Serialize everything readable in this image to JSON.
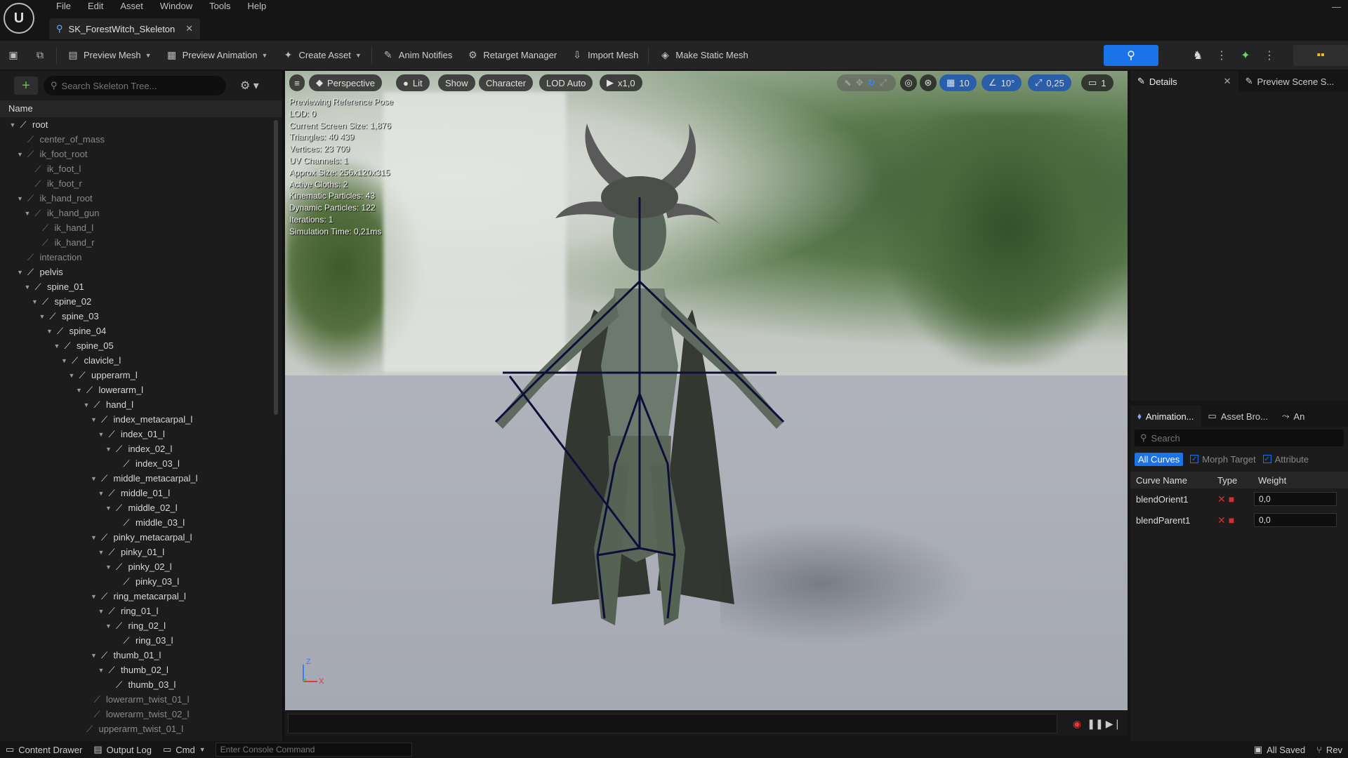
{
  "menu": [
    "File",
    "Edit",
    "Asset",
    "Window",
    "Tools",
    "Help"
  ],
  "doc_tab": {
    "label": "SK_ForestWitch_Skeleton"
  },
  "toolbar": {
    "preview_mesh": "Preview Mesh",
    "preview_animation": "Preview Animation",
    "create_asset": "Create Asset",
    "anim_notifies": "Anim Notifies",
    "retarget_manager": "Retarget Manager",
    "import_mesh": "Import Mesh",
    "make_static_mesh": "Make Static Mesh"
  },
  "skeleton_tree": {
    "search_placeholder": "Search Skeleton Tree...",
    "column_name": "Name",
    "rows": [
      {
        "label": "root",
        "depth": 0,
        "expanded": true,
        "dim": false
      },
      {
        "label": "center_of_mass",
        "depth": 1,
        "expanded": null,
        "dim": true
      },
      {
        "label": "ik_foot_root",
        "depth": 1,
        "expanded": true,
        "dim": true
      },
      {
        "label": "ik_foot_l",
        "depth": 2,
        "expanded": null,
        "dim": true
      },
      {
        "label": "ik_foot_r",
        "depth": 2,
        "expanded": null,
        "dim": true
      },
      {
        "label": "ik_hand_root",
        "depth": 1,
        "expanded": true,
        "dim": true
      },
      {
        "label": "ik_hand_gun",
        "depth": 2,
        "expanded": true,
        "dim": true
      },
      {
        "label": "ik_hand_l",
        "depth": 3,
        "expanded": null,
        "dim": true
      },
      {
        "label": "ik_hand_r",
        "depth": 3,
        "expanded": null,
        "dim": true
      },
      {
        "label": "interaction",
        "depth": 1,
        "expanded": null,
        "dim": true
      },
      {
        "label": "pelvis",
        "depth": 1,
        "expanded": true,
        "dim": false
      },
      {
        "label": "spine_01",
        "depth": 2,
        "expanded": true,
        "dim": false
      },
      {
        "label": "spine_02",
        "depth": 3,
        "expanded": true,
        "dim": false
      },
      {
        "label": "spine_03",
        "depth": 4,
        "expanded": true,
        "dim": false
      },
      {
        "label": "spine_04",
        "depth": 5,
        "expanded": true,
        "dim": false
      },
      {
        "label": "spine_05",
        "depth": 6,
        "expanded": true,
        "dim": false
      },
      {
        "label": "clavicle_l",
        "depth": 7,
        "expanded": true,
        "dim": false
      },
      {
        "label": "upperarm_l",
        "depth": 8,
        "expanded": true,
        "dim": false
      },
      {
        "label": "lowerarm_l",
        "depth": 9,
        "expanded": true,
        "dim": false
      },
      {
        "label": "hand_l",
        "depth": 10,
        "expanded": true,
        "dim": false
      },
      {
        "label": "index_metacarpal_l",
        "depth": 11,
        "expanded": true,
        "dim": false
      },
      {
        "label": "index_01_l",
        "depth": 12,
        "expanded": true,
        "dim": false
      },
      {
        "label": "index_02_l",
        "depth": 13,
        "expanded": true,
        "dim": false
      },
      {
        "label": "index_03_l",
        "depth": 14,
        "expanded": null,
        "dim": false
      },
      {
        "label": "middle_metacarpal_l",
        "depth": 11,
        "expanded": true,
        "dim": false
      },
      {
        "label": "middle_01_l",
        "depth": 12,
        "expanded": true,
        "dim": false
      },
      {
        "label": "middle_02_l",
        "depth": 13,
        "expanded": true,
        "dim": false
      },
      {
        "label": "middle_03_l",
        "depth": 14,
        "expanded": null,
        "dim": false
      },
      {
        "label": "pinky_metacarpal_l",
        "depth": 11,
        "expanded": true,
        "dim": false
      },
      {
        "label": "pinky_01_l",
        "depth": 12,
        "expanded": true,
        "dim": false
      },
      {
        "label": "pinky_02_l",
        "depth": 13,
        "expanded": true,
        "dim": false
      },
      {
        "label": "pinky_03_l",
        "depth": 14,
        "expanded": null,
        "dim": false
      },
      {
        "label": "ring_metacarpal_l",
        "depth": 11,
        "expanded": true,
        "dim": false
      },
      {
        "label": "ring_01_l",
        "depth": 12,
        "expanded": true,
        "dim": false
      },
      {
        "label": "ring_02_l",
        "depth": 13,
        "expanded": true,
        "dim": false
      },
      {
        "label": "ring_03_l",
        "depth": 14,
        "expanded": null,
        "dim": false
      },
      {
        "label": "thumb_01_l",
        "depth": 11,
        "expanded": true,
        "dim": false
      },
      {
        "label": "thumb_02_l",
        "depth": 12,
        "expanded": true,
        "dim": false
      },
      {
        "label": "thumb_03_l",
        "depth": 13,
        "expanded": null,
        "dim": false
      },
      {
        "label": "lowerarm_twist_01_l",
        "depth": 10,
        "expanded": null,
        "dim": true
      },
      {
        "label": "lowerarm_twist_02_l",
        "depth": 10,
        "expanded": null,
        "dim": true
      },
      {
        "label": "upperarm_twist_01_l",
        "depth": 9,
        "expanded": null,
        "dim": true
      }
    ]
  },
  "viewport": {
    "perspective": "Perspective",
    "lit": "Lit",
    "show": "Show",
    "character": "Character",
    "lod": "LOD Auto",
    "play_rate": "x1,0",
    "grid_snap": "10",
    "rot_snap": "10°",
    "scale_snap": "0,25",
    "camera_speed": "1",
    "stats": [
      "Previewing Reference Pose",
      "LOD: 0",
      "Current Screen Size: 1,876",
      "Triangles: 40 439",
      "Vertices: 23 709",
      "UV Channels: 1",
      "Approx Size: 256x120x315",
      "Active Cloths: 2",
      "Kinematic Particles: 43",
      "Dynamic Particles: 122",
      "Iterations: 1",
      "Simulation Time: 0,21ms"
    ],
    "axis_z": "Z",
    "axis_x": "X"
  },
  "details": {
    "tab_details": "Details",
    "tab_preview": "Preview Scene S..."
  },
  "anim_panel": {
    "tab_animation": "Animation...",
    "tab_asset": "Asset Bro...",
    "tab_more": "An",
    "search_placeholder": "Search",
    "filters": [
      "All Curves",
      "Morph Target",
      "Attribute"
    ],
    "col_name": "Curve Name",
    "col_type": "Type",
    "col_weight": "Weight",
    "curves": [
      {
        "name": "blendOrient1",
        "weight": "0,0"
      },
      {
        "name": "blendParent1",
        "weight": "0,0"
      }
    ]
  },
  "statusbar": {
    "content_drawer": "Content Drawer",
    "output_log": "Output Log",
    "cmd": "Cmd",
    "console_placeholder": "Enter Console Command",
    "all_saved": "All Saved",
    "revision": "Rev"
  },
  "colors": {
    "accent": "#1a73e8",
    "bone": "#0e0e3a",
    "panel": "#1c1c1c"
  }
}
